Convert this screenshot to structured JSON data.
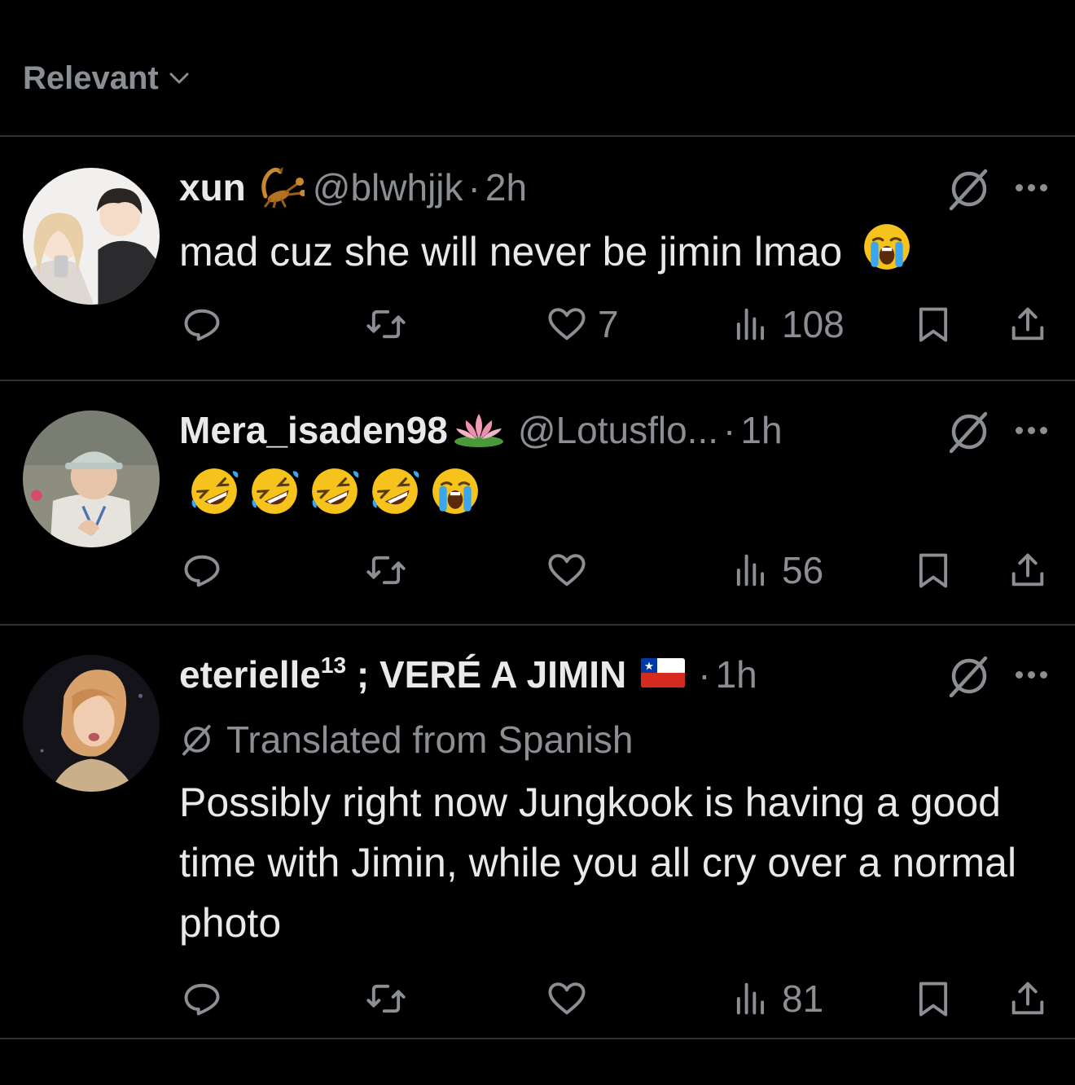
{
  "sort": {
    "label": "Relevant"
  },
  "colors": {
    "background": "#000000",
    "text": "#e7e9ea",
    "muted": "#8b8f94",
    "divider": "#2f3336"
  },
  "replies": [
    {
      "name": "xun",
      "name_emoji": "scorpion",
      "handle": "@blwhjjk",
      "separator": "·",
      "time": "2h",
      "text": "mad cuz she will never be jimin lmao",
      "text_emojis": [
        "loudly-crying-face"
      ],
      "likes": "7",
      "views": "108"
    },
    {
      "name": "Mera_isaden98",
      "name_emoji": "lotus",
      "handle": "@Lotusflo...",
      "separator": "·",
      "time": "1h",
      "text": "",
      "text_emojis": [
        "rolling-on-floor-laughing",
        "rolling-on-floor-laughing",
        "rolling-on-floor-laughing",
        "rolling-on-floor-laughing",
        "loudly-crying-face"
      ],
      "likes": "",
      "views": "56"
    },
    {
      "name": "eterielle",
      "name_sup": "13",
      "name_suffix": " ; VERÉ A JIMIN",
      "name_emoji": "chile-flag",
      "separator": "·",
      "time": "1h",
      "translated_label": "Translated from Spanish",
      "text": "Possibly right now Jungkook is having a good time with Jimin, while you all cry over a normal photo",
      "likes": "",
      "views": "81"
    }
  ]
}
